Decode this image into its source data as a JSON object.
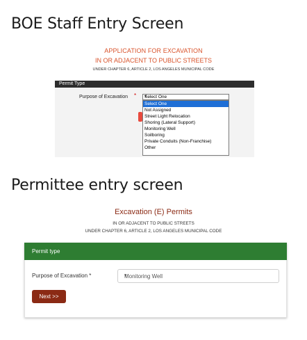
{
  "boe_heading": "BOE Staff Entry Screen",
  "permittee_heading": "Permittee entry screen",
  "boe": {
    "title_line1": "APPLICATION FOR EXCAVATION",
    "title_line2": "IN OR ADJACENT TO PUBLIC STREETS",
    "title_line3": "UNDER CHAPTER 6, ARTICLE 2, LOS ANGELES MUNICIPAL CODE",
    "section_label": "Permit Type",
    "field_label": "Purpose of Excavation",
    "required_marker": "*",
    "selected_value": "Select One",
    "dropdown_arrow": "▾",
    "options": [
      "Select One",
      "Not Assigned",
      "Street Light Relocation",
      "Shoring (Lateral Support)",
      "Monitoring Well",
      "Soilboring",
      "Private Conduits (Non-Franchise)",
      "Other"
    ],
    "highlighted_option_index": 0,
    "colors": {
      "title": "#d9532b",
      "header_bar": "#2d2d2d",
      "highlight": "#1f6fd6",
      "required": "#d10000"
    }
  },
  "permittee": {
    "title": "Excavation (E) Permits",
    "subtitle_line1": "IN OR ADJACENT TO PUBLIC STREETS",
    "subtitle_line2": "UNDER CHAPTER 6, ARTICLE 2, LOS ANGELES MUNICIPAL CODE",
    "section_label": "Permit type",
    "field_label": "Purpose of Excavation *",
    "selected_value": "Monitoring Well",
    "dropdown_arrow": "▾",
    "next_button": "Next >>",
    "colors": {
      "title": "#8b2a14",
      "header_bar": "#2e7d32",
      "button": "#8b2a14"
    }
  }
}
